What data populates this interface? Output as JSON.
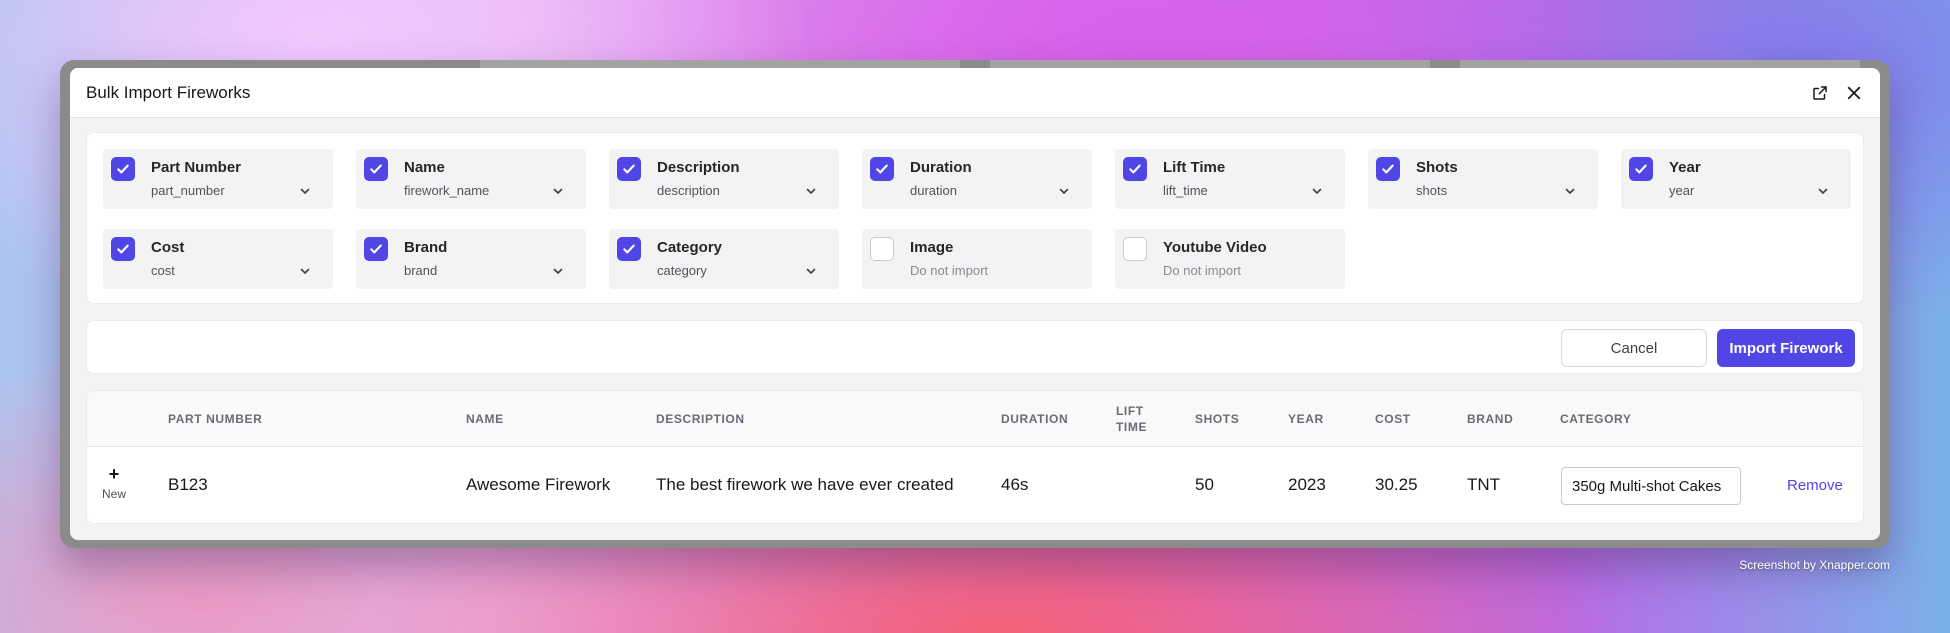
{
  "modal": {
    "title": "Bulk Import Fireworks",
    "icons": [
      "external-link-icon",
      "close-icon"
    ]
  },
  "mapping": {
    "fields": [
      {
        "label": "Part Number",
        "value": "part_number",
        "checked": true
      },
      {
        "label": "Name",
        "value": "firework_name",
        "checked": true
      },
      {
        "label": "Description",
        "value": "description",
        "checked": true
      },
      {
        "label": "Duration",
        "value": "duration",
        "checked": true
      },
      {
        "label": "Lift Time",
        "value": "lift_time",
        "checked": true
      },
      {
        "label": "Shots",
        "value": "shots",
        "checked": true
      },
      {
        "label": "Year",
        "value": "year",
        "checked": true
      },
      {
        "label": "Cost",
        "value": "cost",
        "checked": true
      },
      {
        "label": "Brand",
        "value": "brand",
        "checked": true
      },
      {
        "label": "Category",
        "value": "category",
        "checked": true
      },
      {
        "label": "Image",
        "value": "Do not import",
        "checked": false
      },
      {
        "label": "Youtube Video",
        "value": "Do not import",
        "checked": false
      }
    ]
  },
  "actions": {
    "cancel_label": "Cancel",
    "import_label": "Import Firework"
  },
  "table": {
    "headers": {
      "part_number": "PART NUMBER",
      "name": "NAME",
      "description": "DESCRIPTION",
      "duration": "DURATION",
      "lift_time_line1": "LIFT",
      "lift_time_line2": "TIME",
      "shots": "SHOTS",
      "year": "YEAR",
      "cost": "COST",
      "brand": "BRAND",
      "category": "CATEGORY"
    },
    "rows": [
      {
        "new_symbol": "+",
        "new_label": "New",
        "part_number": "B123",
        "name": "Awesome Firework",
        "description": "The best firework we have ever created",
        "duration": "46s",
        "lift_time": "",
        "shots": "50",
        "year": "2023",
        "cost": "30.25",
        "brand": "TNT",
        "category": "350g Multi-shot Cakes",
        "remove_label": "Remove"
      }
    ]
  },
  "watermark": "Screenshot by Xnapper.com",
  "colors": {
    "accent": "#4f46e5",
    "checkbox_off_border": "#c9c9cf",
    "field_bg": "#f3f3f4"
  }
}
